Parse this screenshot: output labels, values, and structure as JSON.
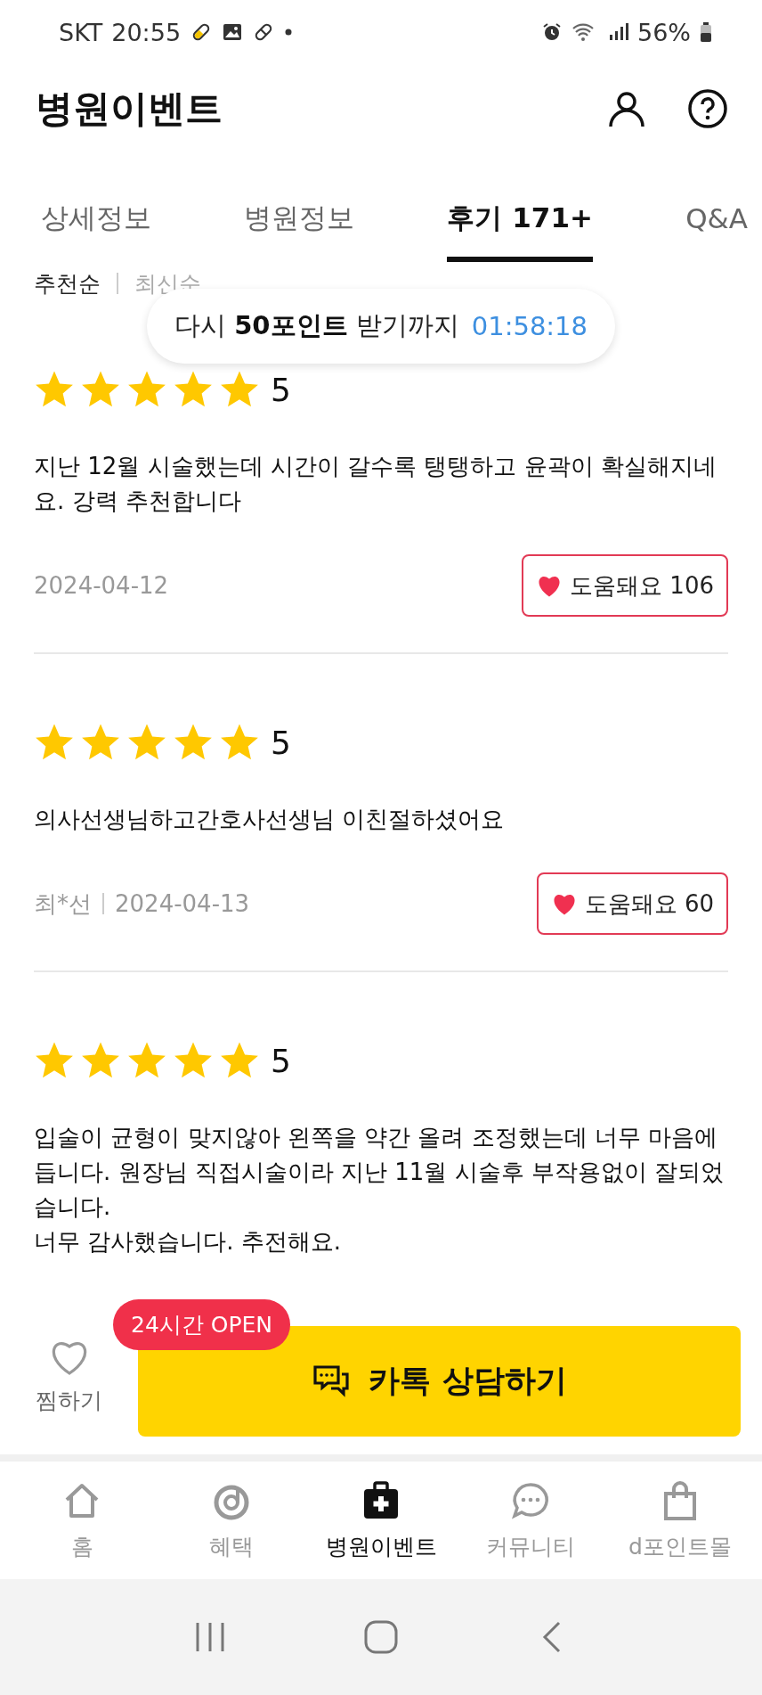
{
  "status_bar": {
    "carrier": "SKT",
    "time": "20:55",
    "battery": "56%"
  },
  "header": {
    "title": "병원이벤트"
  },
  "tabs": [
    {
      "label": "상세정보",
      "selected": false
    },
    {
      "label": "병원정보",
      "selected": false
    },
    {
      "label": "후기 171+",
      "selected": true
    },
    {
      "label": "Q&A",
      "selected": false
    }
  ],
  "sort_options": [
    {
      "label": "추천순",
      "selected": true
    },
    {
      "label": "최신순",
      "selected": false
    }
  ],
  "toast": {
    "text": "다시 **50포인트** 받기까지",
    "timer": "01:58:18"
  },
  "reviews": [
    {
      "stars": 5,
      "score": "5",
      "text": "지난 12월 시술했는데 시간이 갈수록 탱탱하고 윤곽이 확실해지네요. 강력 추천합니다",
      "date": "2024-04-12",
      "helpful_label": "도움돼요",
      "helpful_count": "106"
    },
    {
      "stars": 5,
      "score": "5",
      "text": "의사선생님하고간호사선생님 이친절하셨어요",
      "author": "최*선",
      "date": "2024-04-13",
      "helpful_label": "도움돼요",
      "helpful_count": "60"
    },
    {
      "stars": 5,
      "score": "5",
      "text": "입술이 균형이 맞지않아 왼쪽을 약간 올려 조정했는데 너무 마음에 듭니다. 원장님 직접시술이라 지난 11월 시술후 부작용없이 잘되었습니다.\n너무 감사했습니다. 추전해요."
    }
  ],
  "action_bar": {
    "wish_label": "찜하기",
    "badge": "24시간 OPEN",
    "consult_button": "카톡 상담하기"
  },
  "bottom_nav": [
    {
      "label": "홈",
      "kind": "home",
      "selected": false
    },
    {
      "label": "혜택",
      "kind": "benefit",
      "selected": false
    },
    {
      "label": "병원이벤트",
      "kind": "hospital",
      "selected": true
    },
    {
      "label": "커뮤니티",
      "kind": "community",
      "selected": false
    },
    {
      "label": "d포인트몰",
      "kind": "mall",
      "selected": false
    }
  ]
}
